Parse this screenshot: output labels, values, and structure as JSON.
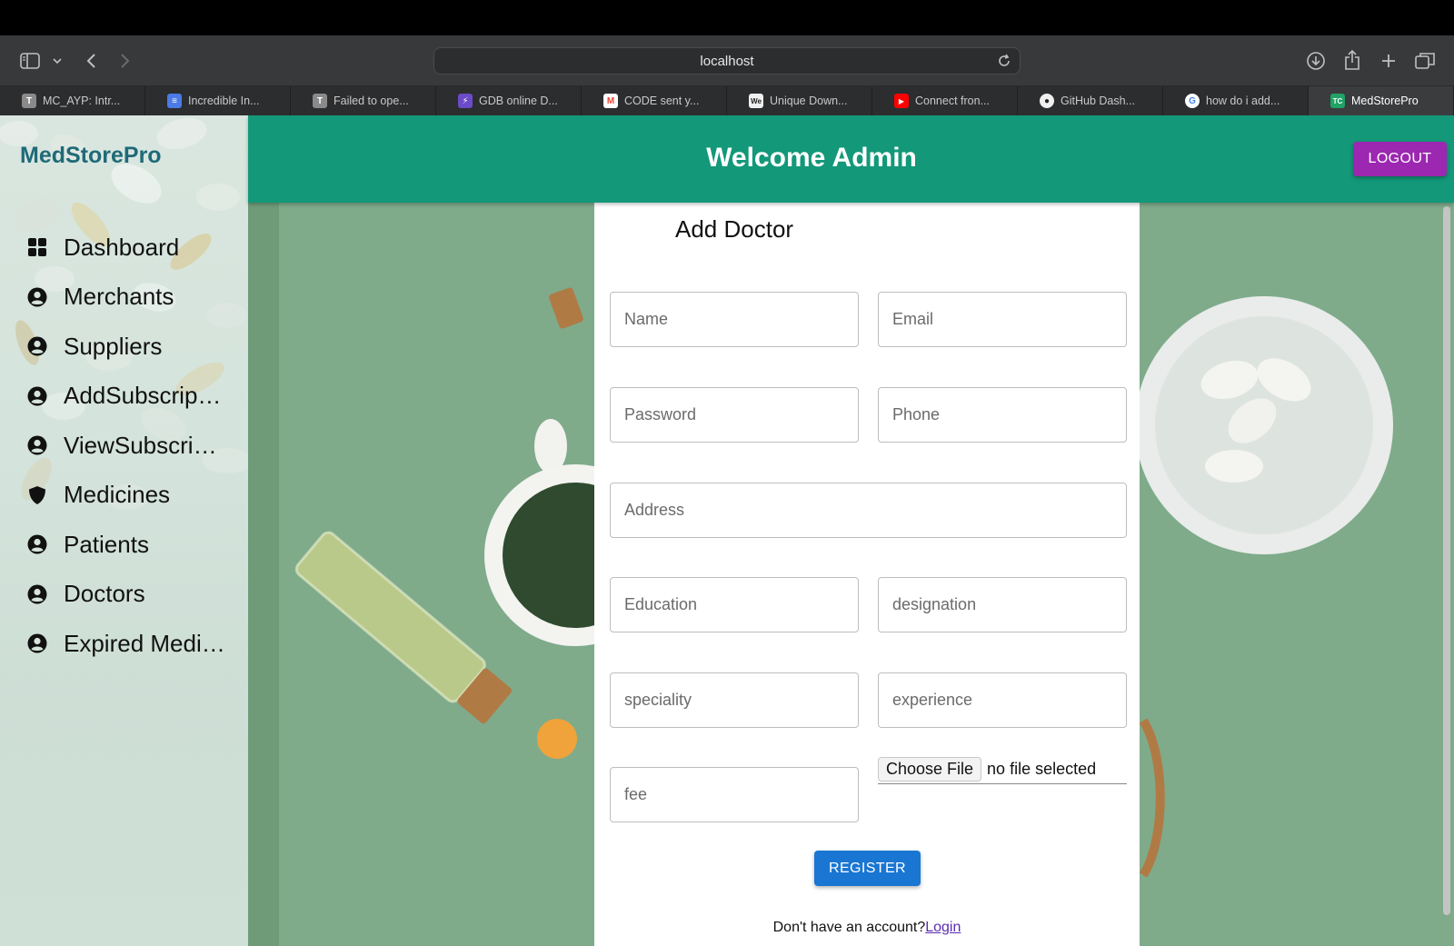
{
  "browser": {
    "url": "localhost",
    "tabs": [
      {
        "label": "MC_AYP: Intr...",
        "icon": "T",
        "color": "#8a8a8a"
      },
      {
        "label": "Incredible In...",
        "icon": "≡",
        "color": "#4a7be6"
      },
      {
        "label": "Failed to ope...",
        "icon": "T",
        "color": "#8a8a8a"
      },
      {
        "label": "GDB online D...",
        "icon": "⚡",
        "color": "#6b4bc7"
      },
      {
        "label": "CODE sent y...",
        "icon": "M",
        "color": "#ea4335"
      },
      {
        "label": "Unique Down...",
        "icon": "We",
        "color": "#333333"
      },
      {
        "label": "Connect fron...",
        "icon": "▶",
        "color": "#ff0000"
      },
      {
        "label": "GitHub Dash...",
        "icon": "●",
        "color": "#f0f0f0"
      },
      {
        "label": "how do i add...",
        "icon": "G",
        "color": "#4285f4"
      },
      {
        "label": "MedStorePro",
        "icon": "TC",
        "color": "#21a366"
      }
    ]
  },
  "sidebar": {
    "brand": "MedStorePro",
    "items": [
      {
        "label": "Dashboard",
        "icon": "grid-icon"
      },
      {
        "label": "Merchants",
        "icon": "user-circle-icon"
      },
      {
        "label": "Suppliers",
        "icon": "user-circle-icon"
      },
      {
        "label": "AddSubscriptions",
        "icon": "user-circle-icon"
      },
      {
        "label": "ViewSubscriptions",
        "icon": "user-circle-icon"
      },
      {
        "label": "Medicines",
        "icon": "shield-icon"
      },
      {
        "label": "Patients",
        "icon": "user-circle-icon"
      },
      {
        "label": "Doctors",
        "icon": "user-circle-icon"
      },
      {
        "label": "Expired Medicines",
        "icon": "user-circle-icon"
      }
    ]
  },
  "header": {
    "title": "Welcome Admin",
    "logout_label": "LOGOUT"
  },
  "form": {
    "title": "Add Doctor",
    "name_placeholder": "Name",
    "email_placeholder": "Email",
    "password_placeholder": "Password",
    "phone_placeholder": "Phone",
    "address_placeholder": "Address",
    "education_placeholder": "Education",
    "designation_placeholder": "designation",
    "speciality_placeholder": "speciality",
    "experience_placeholder": "experience",
    "fee_placeholder": "fee",
    "file_button": "Choose File",
    "file_status": "no file selected",
    "register_label": "REGISTER",
    "account_prompt": "Don't have an account?",
    "login_link": "Login"
  },
  "colors": {
    "header": "#139879",
    "logout": "#9c27b0",
    "register": "#1976d2",
    "brand": "#1f6a78"
  }
}
